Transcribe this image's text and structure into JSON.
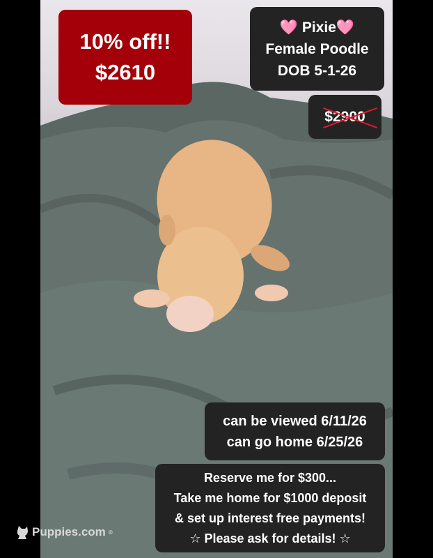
{
  "sale_box": {
    "line1": "10% off!!",
    "line2": "$2610"
  },
  "info_box": {
    "line1": "🩷 Pixie🩷",
    "line2": "Female Poodle",
    "line3": "DOB 5-1-26"
  },
  "old_price": "$2900",
  "dates_box": {
    "line1": "can be viewed 6/11/26",
    "line2": "can go home 6/25/26"
  },
  "reserve_box": {
    "line1": "Reserve me for $300...",
    "line2": "Take me home for $1000 deposit",
    "line3": "& set up interest free payments!",
    "line4": "☆ Please ask for details! ☆"
  },
  "watermark": {
    "text": "Puppies.com",
    "mark": "®"
  },
  "colors": {
    "sale_bg": "#a30009",
    "box_bg": "#232323",
    "strike": "#e0192b"
  },
  "icons": {
    "logo": "puppy-silhouette-icon"
  }
}
